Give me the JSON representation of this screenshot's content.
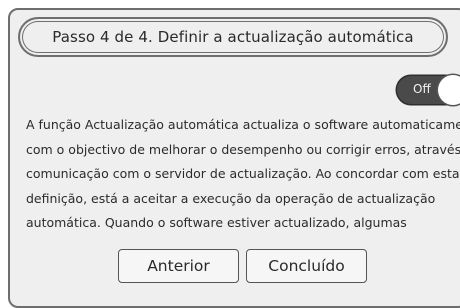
{
  "dialog": {
    "title": "Passo 4 de 4. Definir a actualização automática",
    "toggle": {
      "label": "Off",
      "state": "off"
    },
    "description_lines": [
      "A função Actualização automática actualiza o software automaticamente",
      "com o objectivo de melhorar o desempenho ou corrigir erros, através da",
      "comunicação com o servidor de actualização. Ao concordar com esta",
      "definição, está a aceitar a execução da operação de actualização",
      "automática. Quando o software estiver actualizado, algumas"
    ],
    "buttons": {
      "back": "Anterior",
      "done": "Concluído"
    }
  }
}
